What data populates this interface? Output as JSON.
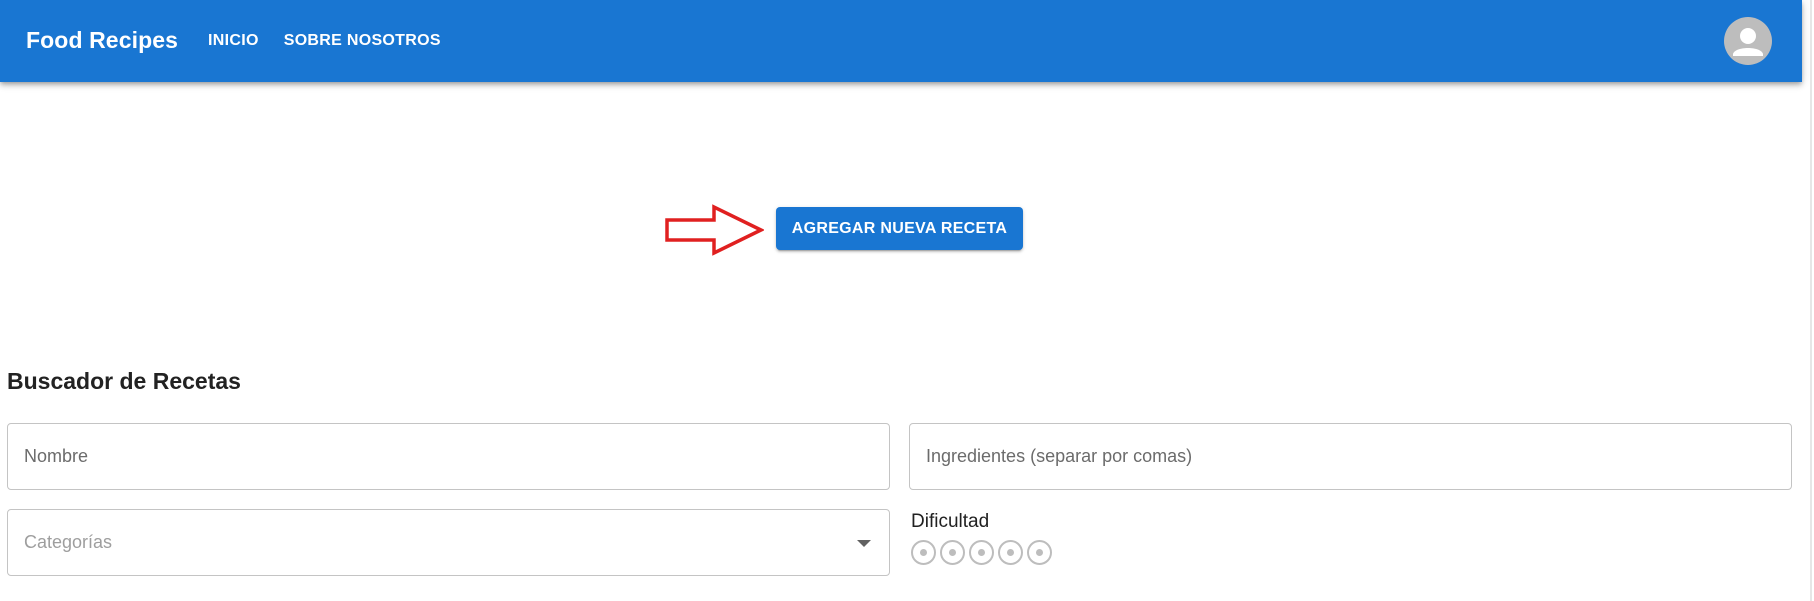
{
  "app": {
    "title": "Food Recipes",
    "nav": [
      {
        "label": "INICIO"
      },
      {
        "label": "SOBRE NOSOTROS"
      }
    ],
    "avatar_icon": "account-circle-icon"
  },
  "cta": {
    "label": "AGREGAR NUEVA RECETA",
    "pointer_icon": "arrow-right-outline-icon"
  },
  "search": {
    "title": "Buscador de Recetas",
    "nombre_placeholder": "Nombre",
    "ingredientes_placeholder": "Ingredientes (separar por comas)",
    "categorias_placeholder": "Categorías",
    "dificultad_label": "Dificultad",
    "difficulty_rating": 0,
    "difficulty_max": 5
  },
  "colors": {
    "primary": "#1976d2",
    "arrow": "#e02020"
  }
}
